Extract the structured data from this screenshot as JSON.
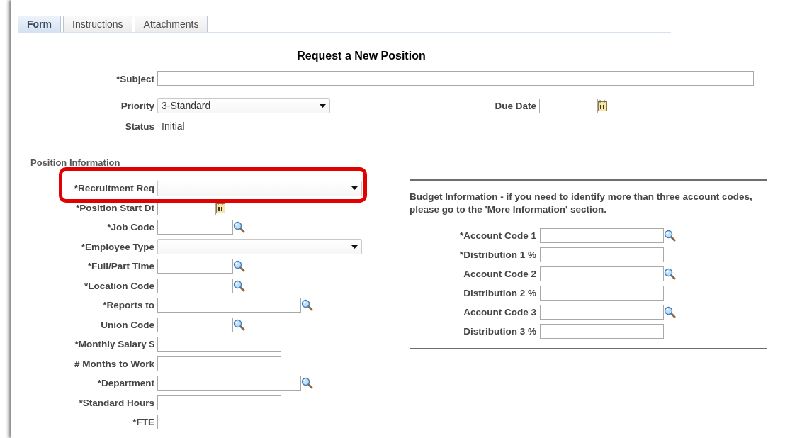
{
  "tabs": [
    {
      "label": "Form",
      "selected": true
    },
    {
      "label": "Instructions",
      "selected": false
    },
    {
      "label": "Attachments",
      "selected": false
    }
  ],
  "title": "Request a New Position",
  "header_fields": [
    {
      "label": "*Subject",
      "kind": "fulltext"
    },
    {
      "label": "Priority",
      "kind": "select",
      "value": "3-Standard"
    },
    {
      "label": "Status",
      "kind": "readonly",
      "value": "Initial"
    }
  ],
  "due_date": {
    "label": "Due Date",
    "kind": "date"
  },
  "position_section": {
    "heading": "Position Information",
    "fields": [
      {
        "label": "*Recruitment Req",
        "kind": "wideselect",
        "highlighted": true
      },
      {
        "label": "*Position Start Dt",
        "kind": "date",
        "highlighted": false
      },
      {
        "label": "*Job Code",
        "kind": "lookup",
        "highlighted": false
      },
      {
        "label": "*Employee Type",
        "kind": "wideselect",
        "highlighted": false
      },
      {
        "label": "*Full/Part Time",
        "kind": "lookup",
        "highlighted": false
      },
      {
        "label": "*Location Code",
        "kind": "lookup",
        "highlighted": false
      },
      {
        "label": "*Reports to",
        "kind": "widelookup",
        "highlighted": false
      },
      {
        "label": "Union Code",
        "kind": "lookup",
        "highlighted": false
      },
      {
        "label": "*Monthly Salary $",
        "kind": "text",
        "highlighted": false
      },
      {
        "label": "# Months to Work",
        "kind": "text",
        "highlighted": false
      },
      {
        "label": "*Department",
        "kind": "widelookup",
        "highlighted": false
      },
      {
        "label": "*Standard Hours",
        "kind": "text",
        "highlighted": false
      },
      {
        "label": "*FTE",
        "kind": "text",
        "highlighted": false
      }
    ]
  },
  "budget_section": {
    "note": "Budget Information - if you need to identify more than three account codes, please go to the 'More Information' section.",
    "fields": [
      {
        "label": "*Account Code 1",
        "kind": "widelookup"
      },
      {
        "label": "*Distribution 1 %",
        "kind": "text"
      },
      {
        "label": "Account Code 2",
        "kind": "widelookup"
      },
      {
        "label": "Distribution 2 %",
        "kind": "text"
      },
      {
        "label": "Account Code 3",
        "kind": "widelookup"
      },
      {
        "label": "Distribution 3 %",
        "kind": "text"
      }
    ]
  }
}
